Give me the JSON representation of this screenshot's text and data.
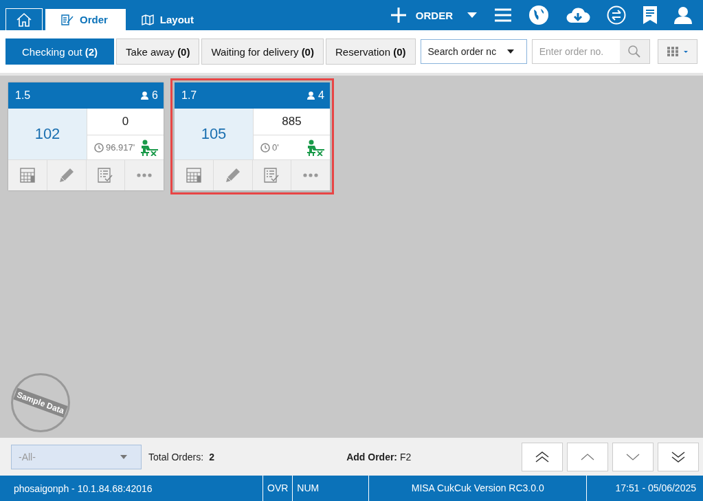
{
  "top_tabs": [
    {
      "kind": "home",
      "selected": false
    },
    {
      "kind": "order",
      "label": "Order",
      "selected": true
    },
    {
      "kind": "layout",
      "label": "Layout",
      "selected": false
    }
  ],
  "order_button": {
    "label": "ORDER"
  },
  "filter_tabs": [
    {
      "label": "Checking out **(2)**",
      "selected": true
    },
    {
      "label": "Take away **(0)**",
      "selected": false
    },
    {
      "label": "Waiting for delivery **(0)**",
      "selected": false
    },
    {
      "label": "Reservation **(0)**",
      "selected": false
    }
  ],
  "search_type": {
    "value": "Search order nc"
  },
  "order_search": {
    "placeholder": "Enter order no."
  },
  "orders": [
    {
      "table": "1.5",
      "guests": "6",
      "number": "102",
      "amount": "0",
      "elapsed": "96.917'",
      "selected": false
    },
    {
      "table": "1.7",
      "guests": "4",
      "number": "105",
      "amount": "885",
      "elapsed": "0'",
      "selected": true
    }
  ],
  "stamp": {
    "text": "Sample Data"
  },
  "footer": {
    "area_filter": "-All-",
    "total_label": "Total Orders:",
    "total": "2",
    "add_order_label": "Add Order:",
    "add_order_key": "F2"
  },
  "status_bar": {
    "server": "phosaigonph - 10.1.84.68:42016",
    "ovr": "OVR",
    "num": "NUM",
    "version": "MISA CukCuk Version RC3.0.0",
    "datetime": "17:51 - 05/06/2025"
  }
}
